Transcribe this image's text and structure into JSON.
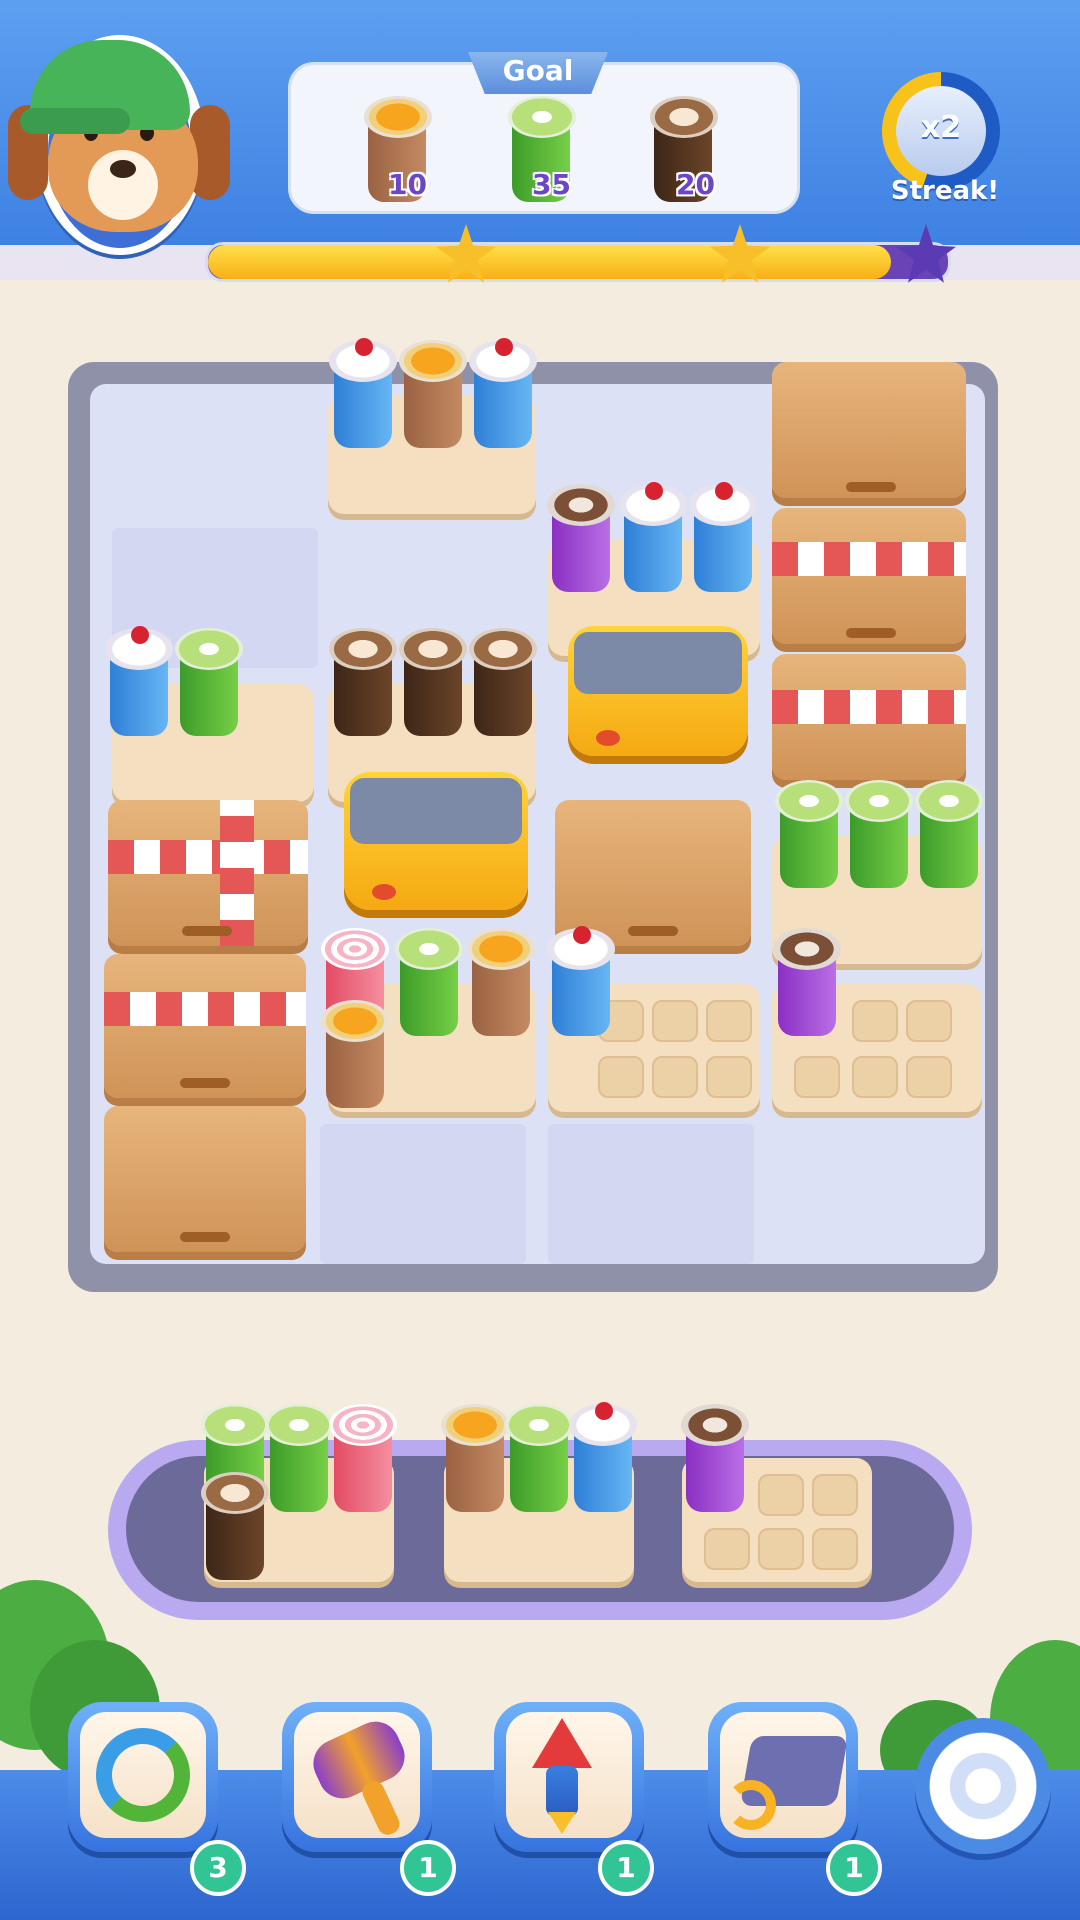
{
  "header": {
    "goal_label": "Goal",
    "goals": [
      {
        "drink": "orange-coffee-cup-icon",
        "count": "10"
      },
      {
        "drink": "matcha-cup-icon",
        "count": "35"
      },
      {
        "drink": "latte-cup-icon",
        "count": "20"
      }
    ],
    "streak": {
      "multiplier": "x2",
      "label": "Streak!"
    },
    "level_progress": 0.93
  },
  "boosters": [
    {
      "name": "shuffle-icon",
      "count": "3"
    },
    {
      "name": "hammer-icon",
      "count": "1"
    },
    {
      "name": "rocket-icon",
      "count": "1"
    },
    {
      "name": "swap-tray-icon",
      "count": "1"
    }
  ],
  "colors": {
    "header_blue": "#3c7fe2",
    "board_frame": "#8f91a9",
    "tray": "#f4dfc1",
    "box": "#d89d62",
    "badge": "#31c494",
    "progress_fill": "#f7b015",
    "progress_track": "#6a44b6"
  }
}
